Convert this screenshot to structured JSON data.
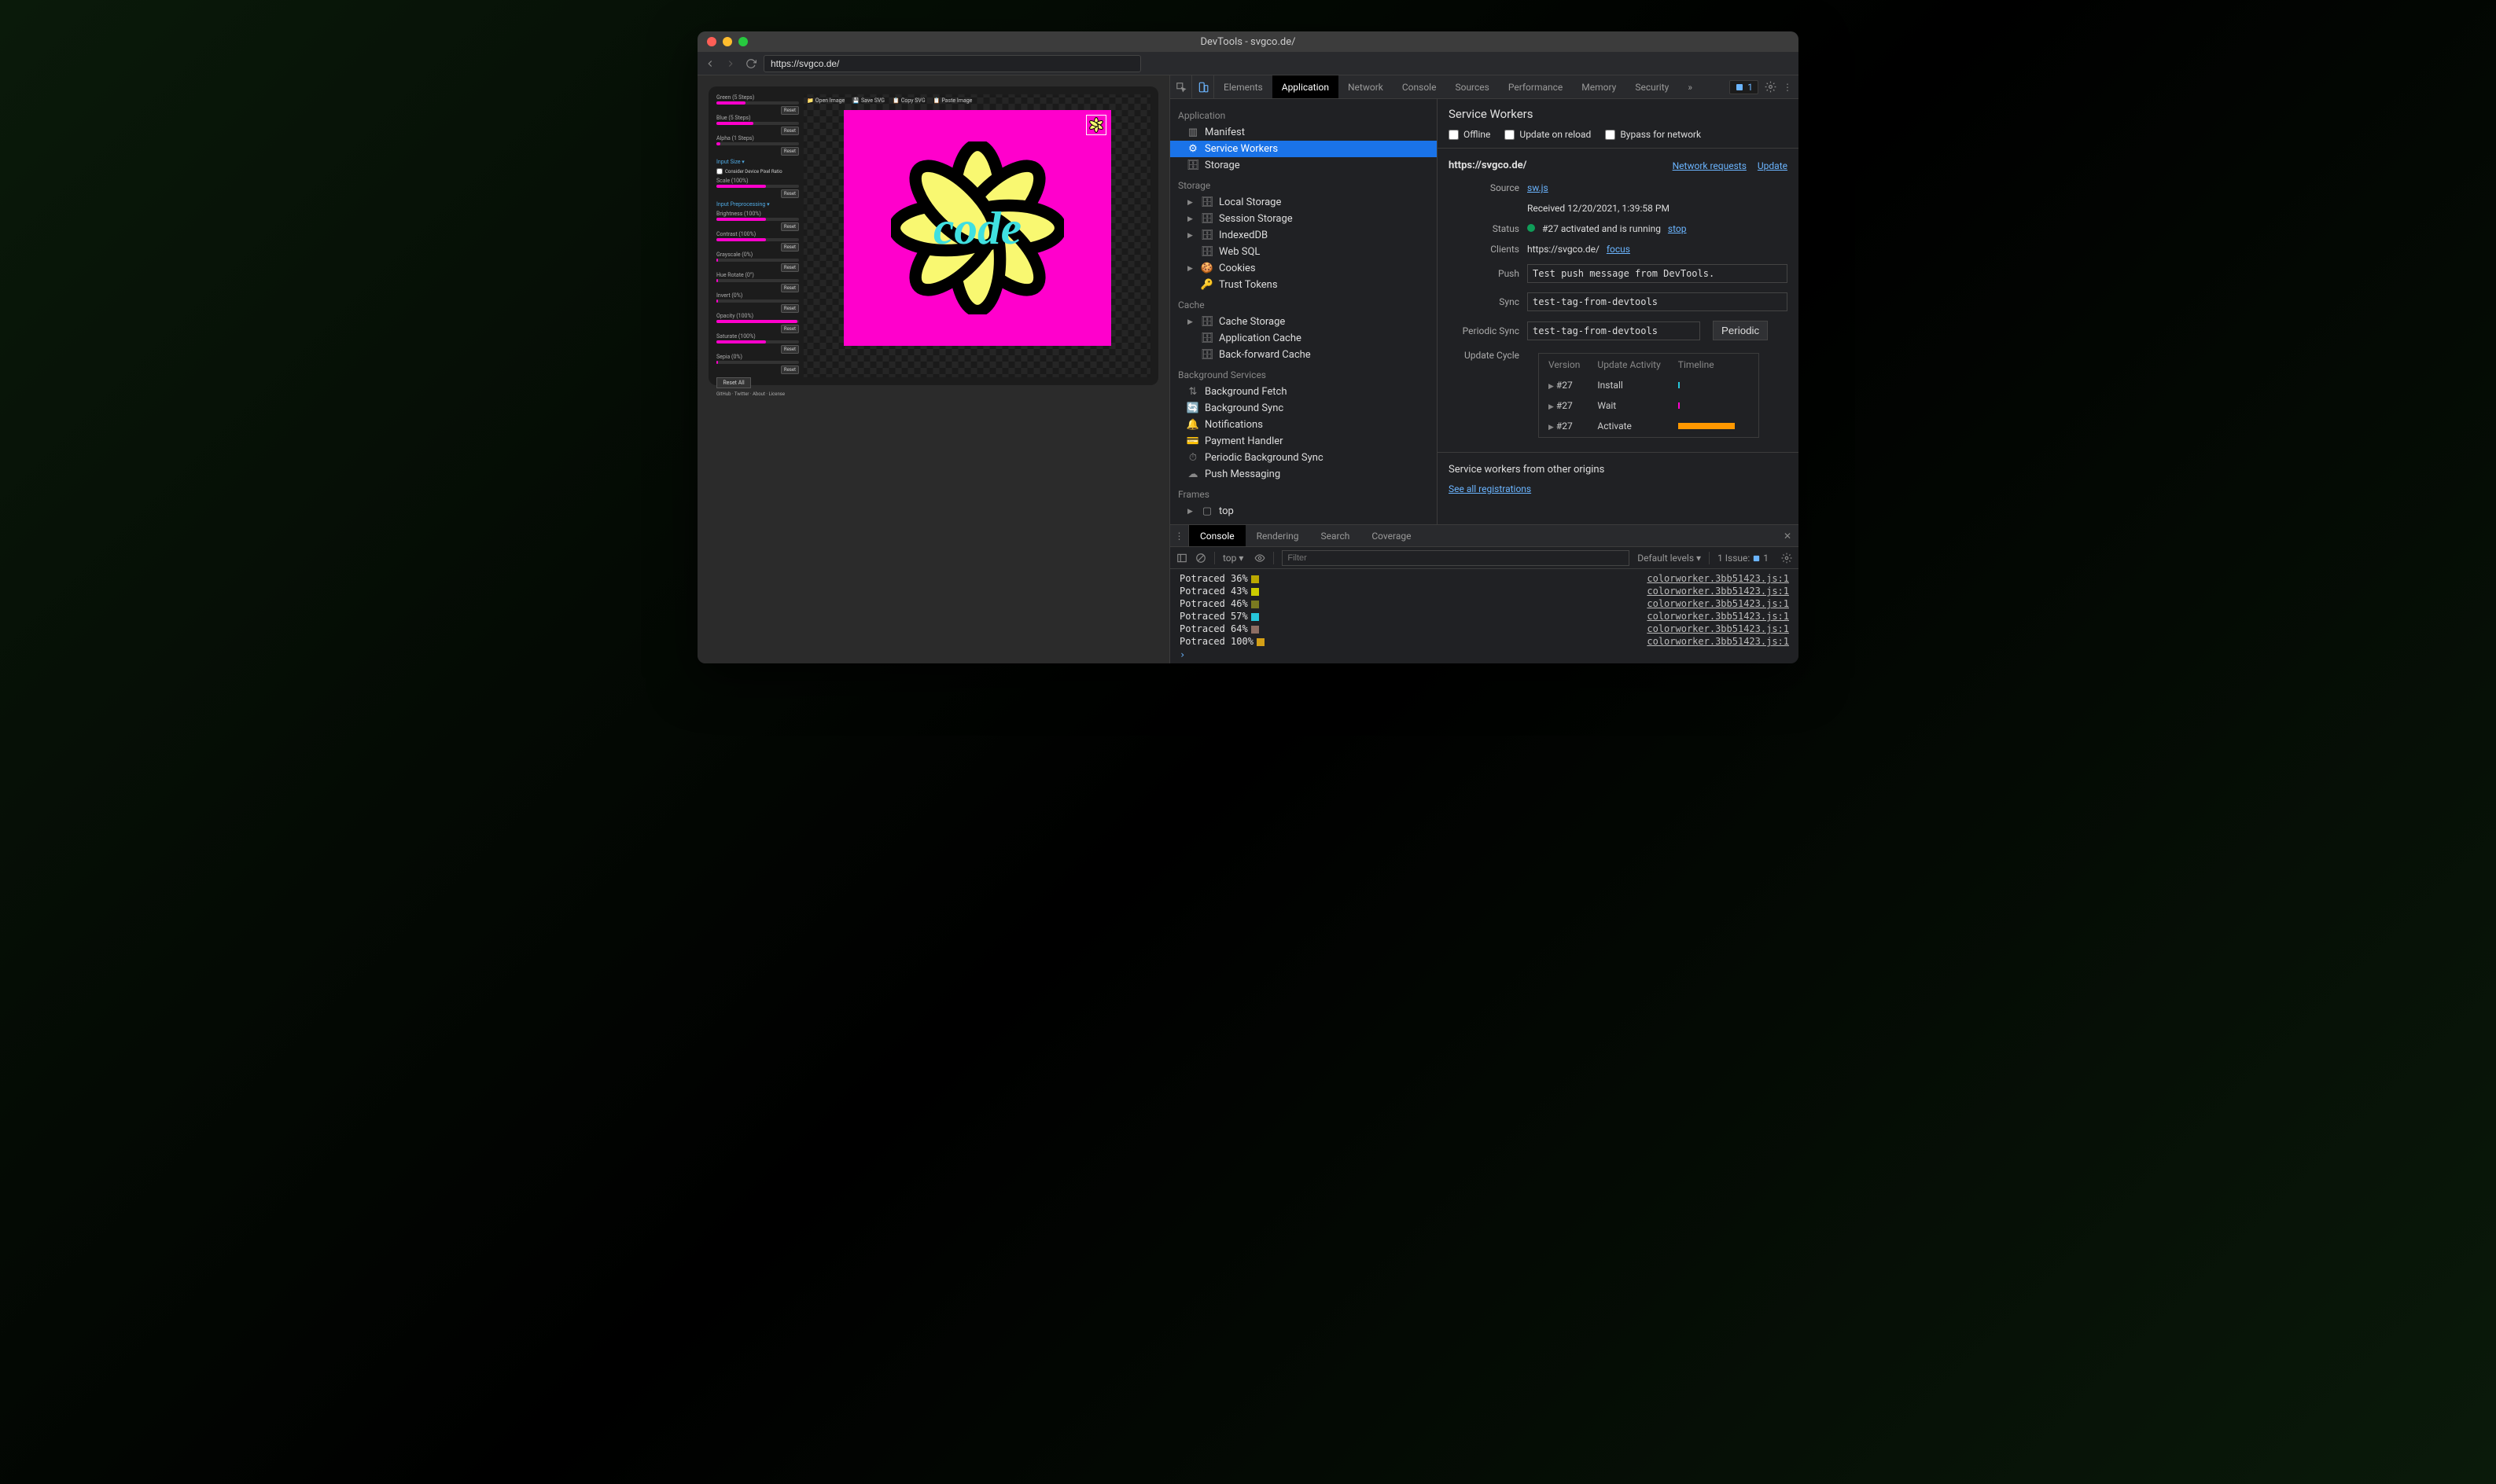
{
  "titlebar": {
    "title": "DevTools - svgco.de/"
  },
  "toolbar": {
    "url": "https://svgco.de/"
  },
  "site": {
    "sliders": [
      {
        "label": "Green (5 Steps)",
        "fill": 35
      },
      {
        "label": "Blue (5 Steps)",
        "fill": 45
      },
      {
        "label": "Alpha (1 Steps)",
        "fill": 5
      }
    ],
    "reset_label": "Reset",
    "input_size_header": "Input Size ▾",
    "device_pixel_label": "Consider Device Pixel Ratio",
    "scale": {
      "label": "Scale (100%)",
      "fill": 60
    },
    "preproc_header": "Input Preprocessing ▾",
    "preproc": [
      {
        "label": "Brightness (100%)",
        "fill": 60
      },
      {
        "label": "Contrast (100%)",
        "fill": 60
      },
      {
        "label": "Grayscale (0%)",
        "fill": 2
      },
      {
        "label": "Hue Rotate (0°)",
        "fill": 2
      },
      {
        "label": "Invert (0%)",
        "fill": 2
      },
      {
        "label": "Opacity (100%)",
        "fill": 98
      },
      {
        "label": "Saturate (100%)",
        "fill": 60
      },
      {
        "label": "Sepia (0%)",
        "fill": 2
      }
    ],
    "reset_all": "Reset All",
    "footer": "GitHub · Twitter · About · License",
    "canvas_toolbar": {
      "open": "Open Image",
      "save": "Save SVG",
      "copy": "Copy SVG",
      "paste": "Paste Image"
    }
  },
  "devtools": {
    "tabs": [
      "Elements",
      "Application",
      "Network",
      "Console",
      "Sources",
      "Performance",
      "Memory",
      "Security"
    ],
    "issues_count": "1",
    "sidebar": {
      "application": {
        "title": "Application",
        "items": [
          "Manifest",
          "Service Workers",
          "Storage"
        ]
      },
      "storage": {
        "title": "Storage",
        "items": [
          "Local Storage",
          "Session Storage",
          "IndexedDB",
          "Web SQL",
          "Cookies",
          "Trust Tokens"
        ]
      },
      "cache": {
        "title": "Cache",
        "items": [
          "Cache Storage",
          "Application Cache",
          "Back-forward Cache"
        ]
      },
      "bg": {
        "title": "Background Services",
        "items": [
          "Background Fetch",
          "Background Sync",
          "Notifications",
          "Payment Handler",
          "Periodic Background Sync",
          "Push Messaging"
        ]
      },
      "frames": {
        "title": "Frames",
        "top": "top"
      }
    },
    "sw": {
      "title": "Service Workers",
      "checks": {
        "offline": "Offline",
        "reload": "Update on reload",
        "bypass": "Bypass for network"
      },
      "host": "https://svgco.de/",
      "links": {
        "net": "Network requests",
        "update": "Update"
      },
      "source_label": "Source",
      "source_value": "sw.js",
      "received": "Received 12/20/2021, 1:39:58 PM",
      "status_label": "Status",
      "status_text": "#27 activated and is running",
      "status_action": "stop",
      "clients_label": "Clients",
      "clients_value": "https://svgco.de/",
      "clients_action": "focus",
      "push_label": "Push",
      "push_value": "Test push message from DevTools.",
      "sync_label": "Sync",
      "sync_value": "test-tag-from-devtools",
      "periodic_label": "Periodic Sync",
      "periodic_value": "test-tag-from-devtools",
      "periodic_btn": "Periodic",
      "cycle_label": "Update Cycle",
      "cycle_headers": [
        "Version",
        "Update Activity",
        "Timeline"
      ],
      "cycle_rows": [
        {
          "version": "#27",
          "activity": "Install",
          "color": "#26c6da",
          "width": 2
        },
        {
          "version": "#27",
          "activity": "Wait",
          "color": "#ff00cc",
          "width": 2
        },
        {
          "version": "#27",
          "activity": "Activate",
          "color": "#ff9800",
          "width": 72
        }
      ],
      "other_title": "Service workers from other origins",
      "other_link": "See all registrations"
    }
  },
  "drawer": {
    "tabs": [
      "Console",
      "Rendering",
      "Search",
      "Coverage"
    ],
    "context": "top",
    "filter_placeholder": "Filter",
    "levels": "Default levels",
    "issue_text": "1 Issue:",
    "issue_count": "1",
    "console": [
      {
        "text": "Potraced 36%",
        "color": "#bba800",
        "src": "colorworker.3bb51423.js:1"
      },
      {
        "text": "Potraced 43%",
        "color": "#cccc00",
        "src": "colorworker.3bb51423.js:1"
      },
      {
        "text": "Potraced 46%",
        "color": "#7a7a20",
        "src": "colorworker.3bb51423.js:1"
      },
      {
        "text": "Potraced 57%",
        "color": "#26c6da",
        "src": "colorworker.3bb51423.js:1"
      },
      {
        "text": "Potraced 64%",
        "color": "#8d6e63",
        "src": "colorworker.3bb51423.js:1"
      },
      {
        "text": "Potraced 100%",
        "color": "#d4a017",
        "src": "colorworker.3bb51423.js:1"
      }
    ]
  }
}
